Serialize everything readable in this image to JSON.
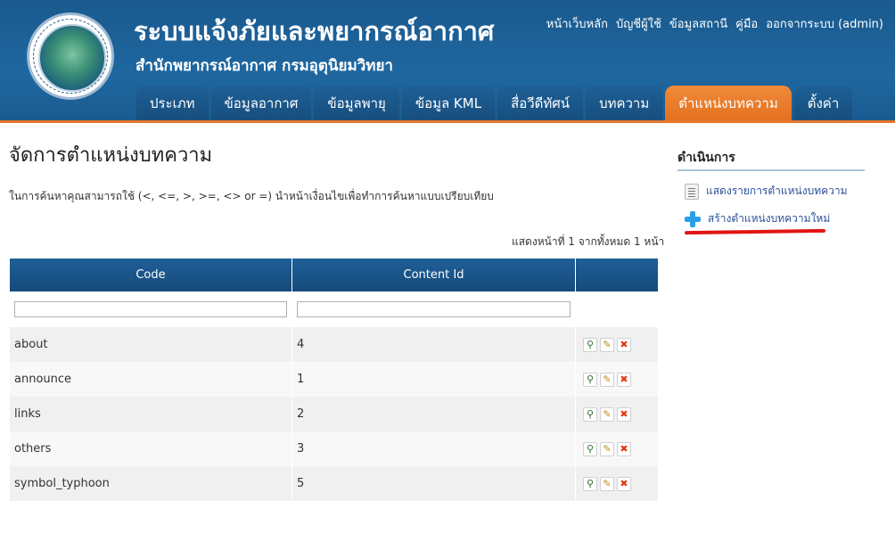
{
  "header": {
    "title": "ระบบแจ้งภัยและพยากรณ์อากาศ",
    "subtitle": "สำนักพยากรณ์อากาศ กรมอุตุนิยมวิทยา",
    "top_links": [
      "หน้าเว็บหลัก",
      "บัญชีผู้ใช้",
      "ข้อมูลสถานี",
      "คู่มือ",
      "ออกจากระบบ (admin)"
    ],
    "tabs": [
      {
        "label": "ประเภท",
        "active": false
      },
      {
        "label": "ข้อมูลอากาศ",
        "active": false
      },
      {
        "label": "ข้อมูลพายุ",
        "active": false
      },
      {
        "label": "ข้อมูล KML",
        "active": false
      },
      {
        "label": "สื่อวีดีทัศน์",
        "active": false
      },
      {
        "label": "บทความ",
        "active": false
      },
      {
        "label": "ตำแหน่งบทความ",
        "active": true
      },
      {
        "label": "ตั้งค่า",
        "active": false
      }
    ]
  },
  "main": {
    "title": "จัดการตำแหน่งบทความ",
    "hint": "ในการค้นหาคุณสามารถใช้ (<, <=, >, >=, <> or =) นำหน้าเงื่อนไขเพื่อทำการค้นหาแบบเปรียบเทียบ",
    "summary": "แสดงหน้าที่ 1 จากทั้งหมด 1 หน้า",
    "columns": [
      "Code",
      "Content Id",
      ""
    ],
    "filters": {
      "code": "",
      "content_id": ""
    },
    "rows": [
      {
        "code": "about",
        "content_id": "4"
      },
      {
        "code": "announce",
        "content_id": "1"
      },
      {
        "code": "links",
        "content_id": "2"
      },
      {
        "code": "others",
        "content_id": "3"
      },
      {
        "code": "symbol_typhoon",
        "content_id": "5"
      }
    ],
    "row_action_icons": [
      "view-icon",
      "edit-icon",
      "delete-icon"
    ]
  },
  "sidebar": {
    "title": "ดำเนินการ",
    "items": [
      {
        "label": "แสดงรายการตำแหน่งบทความ",
        "icon": "list-icon"
      },
      {
        "label": "สร้างตำแหน่งบทความใหม่",
        "icon": "add-icon"
      }
    ],
    "annotation_color": "#e21414"
  },
  "colors": {
    "header_bg": "#1f67a0",
    "active_tab": "#e3711f",
    "table_header": "#164a7a",
    "link": "#2a4f9a"
  }
}
